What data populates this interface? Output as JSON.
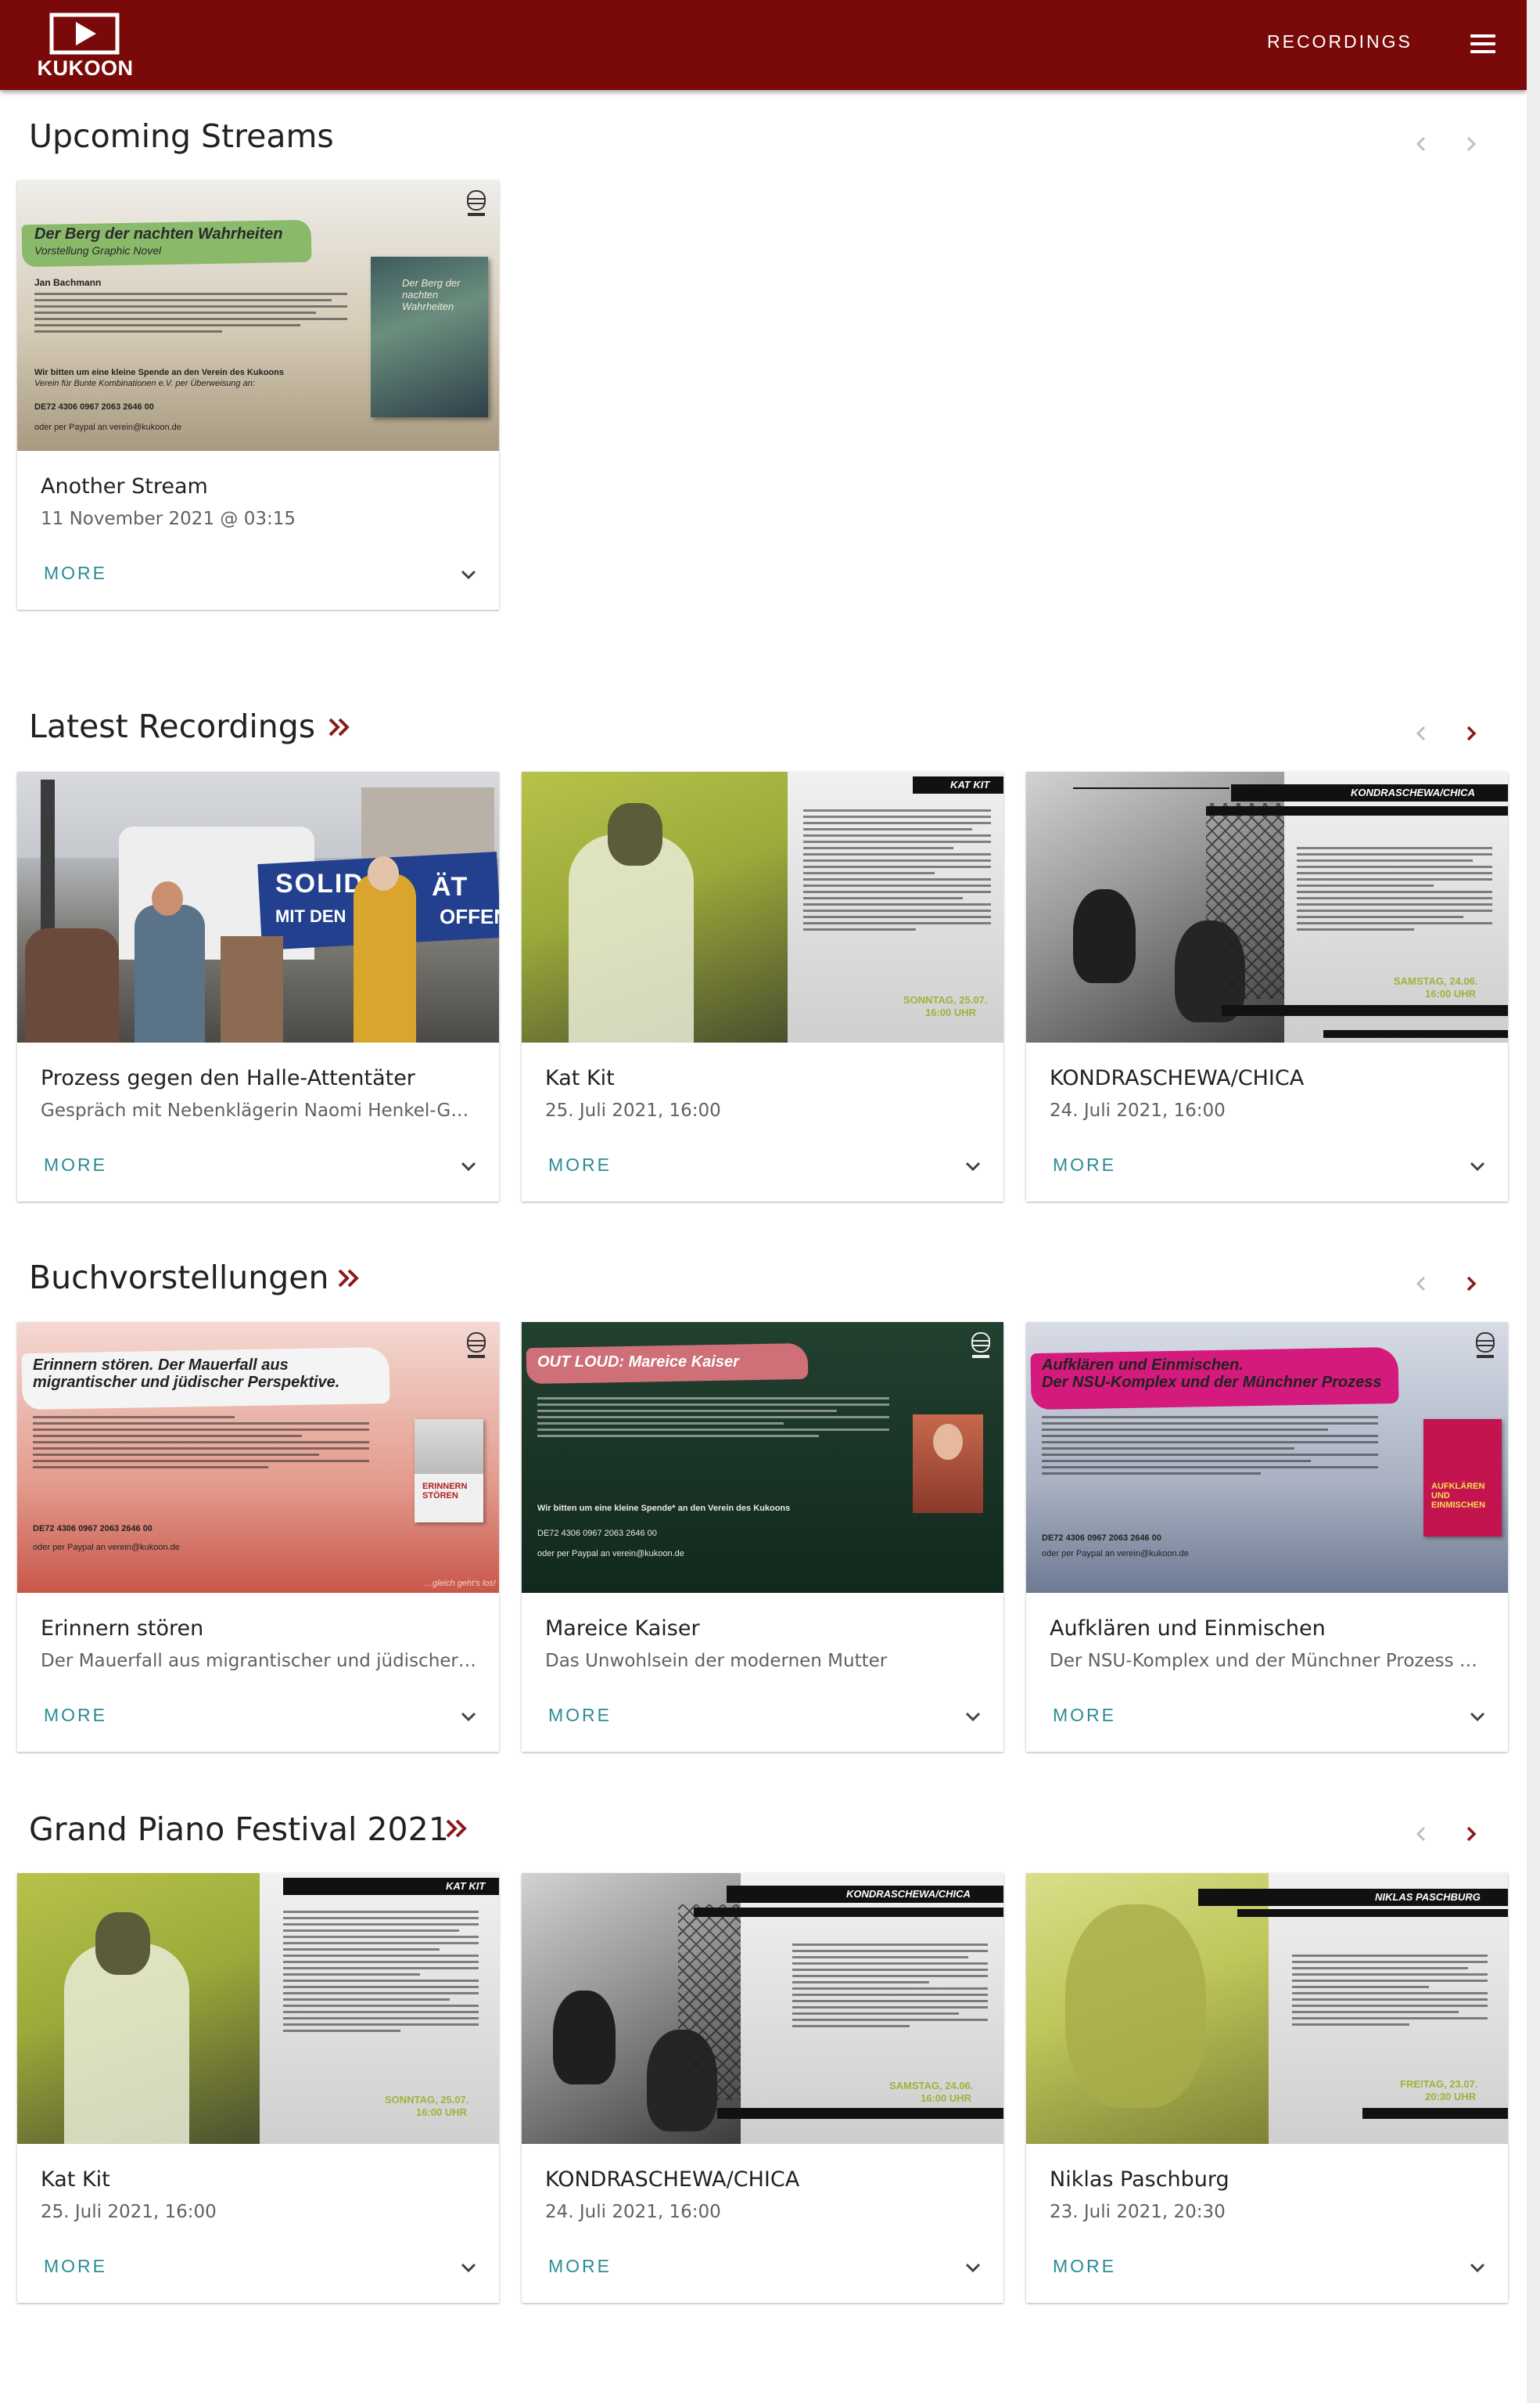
{
  "header": {
    "logo_text": "KUKOON",
    "nav_recordings": "RECORDINGS",
    "menu_icon": "hamburger-menu-icon",
    "background_color": "#7a0a0a"
  },
  "accent_color": "#2a8c95",
  "sections": [
    {
      "title": "Upcoming Streams",
      "cards": [
        {
          "title": "Another Stream",
          "subtitle": "11 November 2021 @ 03:15",
          "more_label": "MORE",
          "poster": {
            "brush_title": "Der Berg der nachten Wahrheiten",
            "brush_subtitle": "Vorstellung Graphic Novel",
            "author": "Jan Bachmann",
            "bank": "DE72  4306 0967  2063  2646  00",
            "paypal": "oder per Paypal an verein@kukoon.de",
            "donation": "Wir bitten um eine kleine Spende an den Verein des Kukoons",
            "donation2": "Verein für Bunte Kombinationen e.V. per Überweisung an:",
            "book_title": "Der Berg der nachten Wahrheiten"
          }
        }
      ]
    },
    {
      "title": "Latest Recordings",
      "cards": [
        {
          "title": "Prozess gegen den Halle-Attentäter",
          "subtitle": "Gespräch mit Nebenklägerin Naomi Henkel-Gü…",
          "more_label": "MORE",
          "poster": {
            "banner_1": "SOLID",
            "banner_2": "ÄT",
            "banner_3": "MIT DEN",
            "banner_4": "OFFENE"
          }
        },
        {
          "title": "Kat Kit",
          "subtitle": "25. Juli 2021, 16:00",
          "more_label": "MORE",
          "poster": {
            "tag": "KAT KIT",
            "date": "SONNTAG, 25.07.",
            "time": "16:00 UHR"
          }
        },
        {
          "title": "KONDRASCHEWA/CHICA",
          "subtitle": "24. Juli 2021, 16:00",
          "more_label": "MORE",
          "poster": {
            "tag": "KONDRASCHEWA/CHICA",
            "date": "SAMSTAG, 24.06.",
            "time": "16:00 UHR"
          }
        }
      ]
    },
    {
      "title": "Buchvorstellungen",
      "cards": [
        {
          "title": "Erinnern stören",
          "subtitle": "Der Mauerfall aus migrantischer und jüdischer …",
          "more_label": "MORE",
          "poster": {
            "brush_title": "Erinnern stören. Der Mauerfall aus migrantischer und jüdischer Perspektive.",
            "brush_line1": "Erinnern stören. Der Mauerfall aus",
            "brush_line2": "migrantischer und jüdischer Perspektive.",
            "book": "ERINNERN STÖREN",
            "bank": "DE72  4306 0967  2063  2646  00",
            "paypal": "oder per Paypal an verein@kukoon.de",
            "footer": "…gleich geht's los!"
          }
        },
        {
          "title": "Mareice Kaiser",
          "subtitle": "Das Unwohlsein der modernen Mutter",
          "more_label": "MORE",
          "poster": {
            "brush_title": "OUT LOUD: Mareice Kaiser",
            "bank": "DE72  4306 0967  2063  2646  00",
            "paypal": "oder per Paypal an verein@kukoon.de",
            "donation": "Wir bitten um eine kleine Spende* an den Verein des Kukoons"
          }
        },
        {
          "title": "Aufklären und Einmischen",
          "subtitle": "Der NSU-Komplex und der Münchner Prozess …",
          "more_label": "MORE",
          "poster": {
            "brush_line1": "Aufklären und Einmischen.",
            "brush_line2": "Der NSU-Komplex und der Münchner Prozess",
            "book": "AUFKLÄREN UND EINMISCHEN",
            "bank": "DE72  4306 0967  2063  2646  00",
            "paypal": "oder per Paypal an verein@kukoon.de"
          }
        }
      ]
    },
    {
      "title": "Grand Piano Festival 2021",
      "cards": [
        {
          "title": "Kat Kit",
          "subtitle": "25. Juli 2021, 16:00",
          "more_label": "MORE",
          "poster": {
            "tag": "KAT KIT",
            "date": "SONNTAG, 25.07.",
            "time": "16:00 UHR"
          }
        },
        {
          "title": "KONDRASCHEWA/CHICA",
          "subtitle": "24. Juli 2021, 16:00",
          "more_label": "MORE",
          "poster": {
            "tag": "KONDRASCHEWA/CHICA",
            "date": "SAMSTAG, 24.06.",
            "time": "16:00 UHR"
          }
        },
        {
          "title": "Niklas Paschburg",
          "subtitle": "23. Juli 2021, 20:30",
          "more_label": "MORE",
          "poster": {
            "tag": "NIKLAS PASCHBURG",
            "date": "FREITAG, 23.07.",
            "time": "20:30 UHR"
          }
        }
      ]
    }
  ]
}
